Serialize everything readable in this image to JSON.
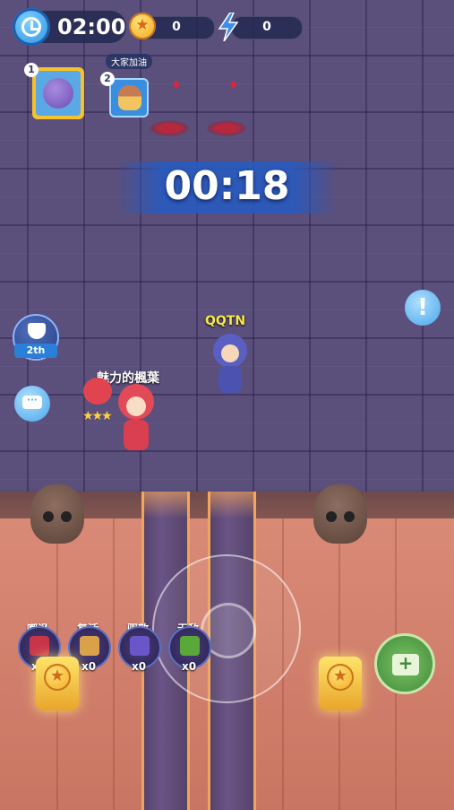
{
  "hud": {
    "match_time": "02:00",
    "coins": "0",
    "energy": "0",
    "round_timer": "00:18"
  },
  "players": [
    {
      "slot": "1",
      "avatar": "purple-monster"
    },
    {
      "slot": "2",
      "avatar": "mushroom-kid",
      "tag": "大家加油"
    }
  ],
  "side": {
    "rank": "2th",
    "alert": "!"
  },
  "characters": {
    "opponent": "QQTN",
    "self": "魅力的楓葉",
    "self_stars": "★★★"
  },
  "skills": [
    {
      "label": "嘲讽",
      "count": "x0",
      "color": "#c8344a"
    },
    {
      "label": "复活",
      "count": "x0",
      "color": "#d9a24a"
    },
    {
      "label": "驱散",
      "count": "x0",
      "color": "#6a56c8"
    },
    {
      "label": "无敌",
      "count": "x0",
      "color": "#5aa83a"
    }
  ],
  "colors": {
    "floor": "#d98a76",
    "board": "#5b4f7c",
    "accent": "#2a7fd8"
  }
}
